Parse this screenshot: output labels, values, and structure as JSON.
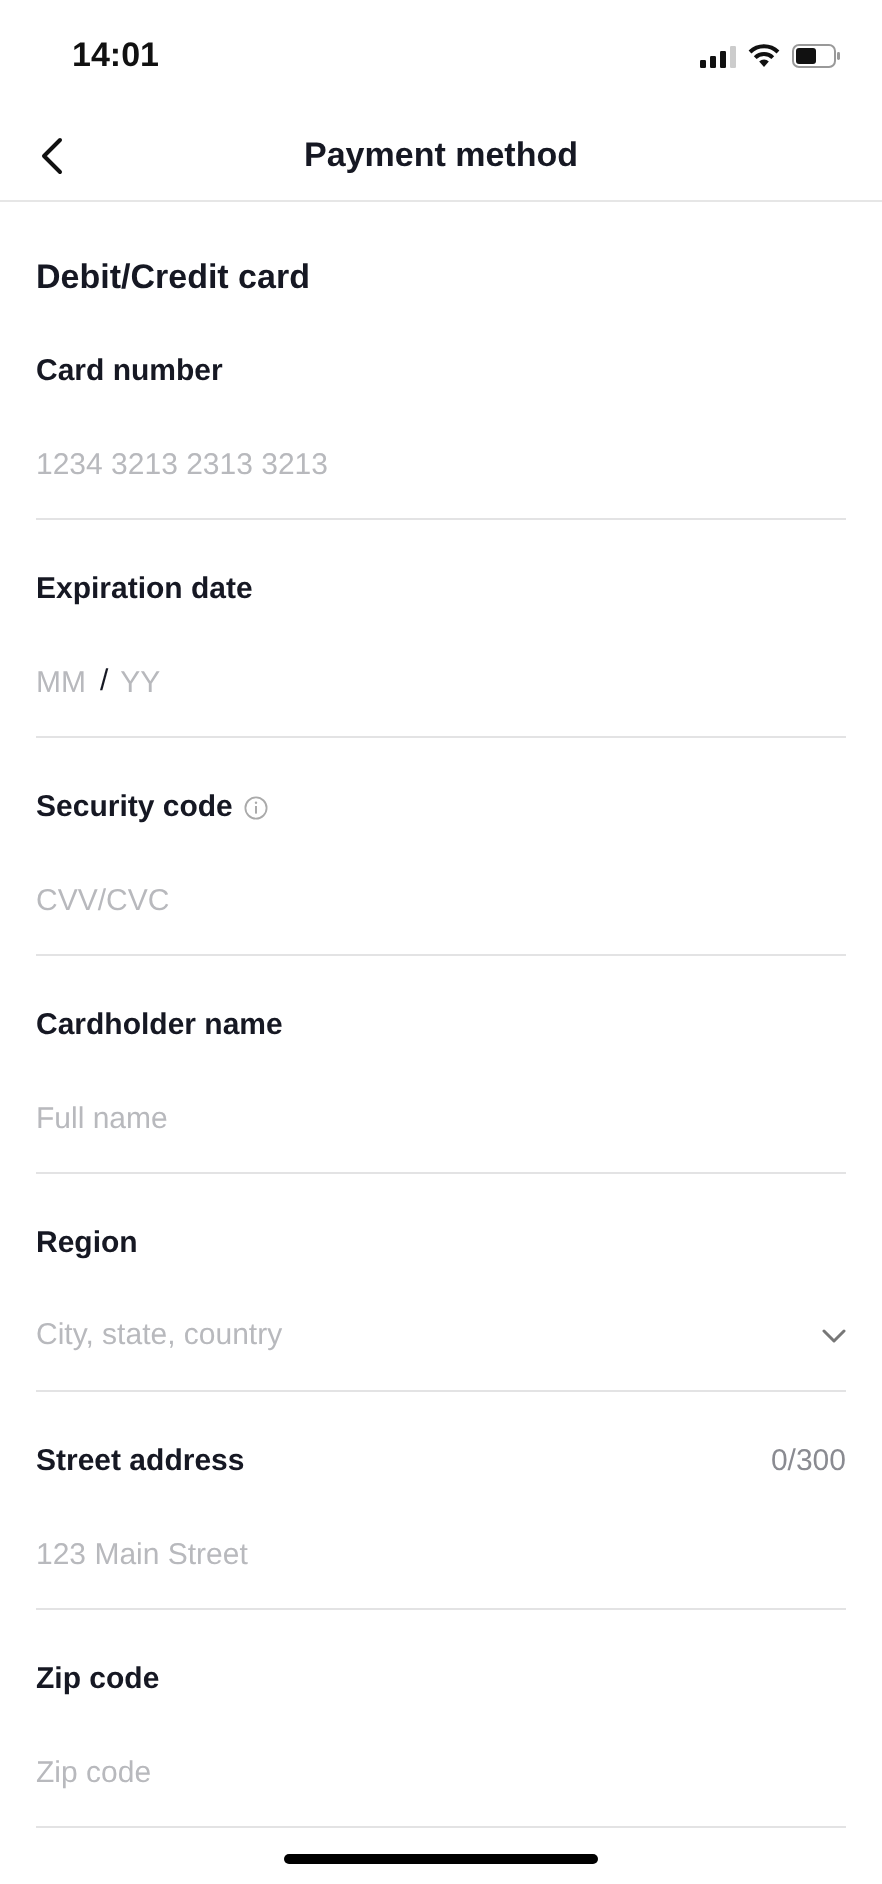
{
  "status_bar": {
    "time": "14:01"
  },
  "header": {
    "title": "Payment method"
  },
  "section": {
    "title": "Debit/Credit card"
  },
  "fields": [
    {
      "kind": "text",
      "label": "Card number",
      "placeholder": "1234 3213 2313 3213"
    },
    {
      "kind": "expiry",
      "label": "Expiration date",
      "month_placeholder": "MM",
      "separator": "/",
      "year_placeholder": "YY"
    },
    {
      "kind": "text",
      "label": "Security code",
      "info": true,
      "placeholder": "CVV/CVC"
    },
    {
      "kind": "text",
      "label": "Cardholder name",
      "placeholder": "Full name"
    },
    {
      "kind": "select",
      "label": "Region",
      "placeholder": "City, state, country"
    },
    {
      "kind": "text",
      "label": "Street address",
      "counter": "0/300",
      "placeholder": "123 Main Street"
    },
    {
      "kind": "text",
      "label": "Zip code",
      "placeholder": "Zip code"
    }
  ]
}
